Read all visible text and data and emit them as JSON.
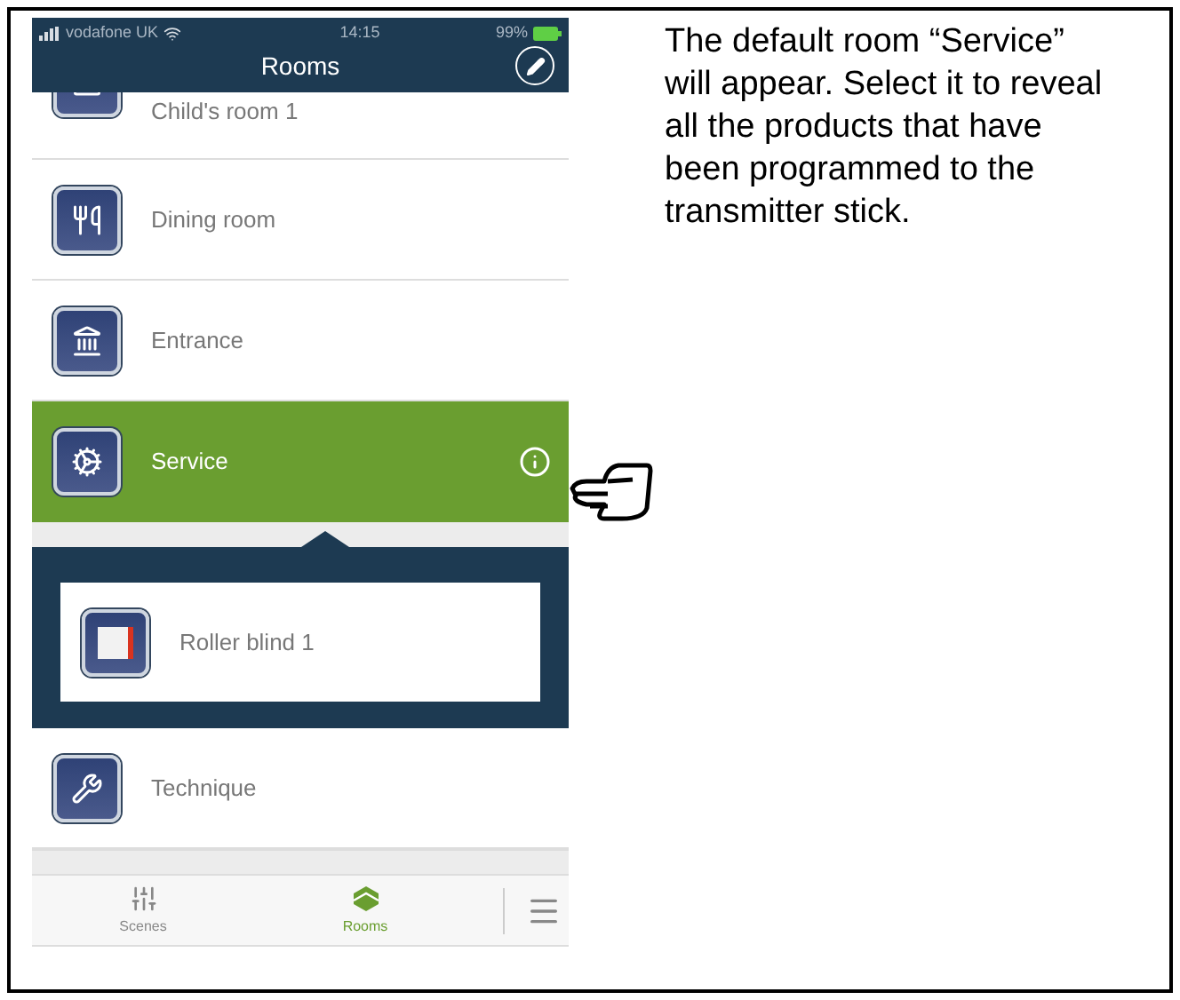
{
  "status_bar": {
    "carrier": "vodafone UK",
    "time": "14:15",
    "battery": "99%"
  },
  "header": {
    "title": "Rooms"
  },
  "rooms": [
    {
      "name": "Child's room 1",
      "selected": false
    },
    {
      "name": "Dining room",
      "selected": false
    },
    {
      "name": "Entrance",
      "selected": false
    },
    {
      "name": "Service",
      "selected": true,
      "devices": [
        {
          "name": "Roller blind 1"
        }
      ]
    },
    {
      "name": "Technique",
      "selected": false
    }
  ],
  "tab_bar": [
    {
      "label": "Scenes",
      "selected": false
    },
    {
      "label": "Rooms",
      "selected": true
    }
  ],
  "instruction": "The default room “Service” will appear. Select it to reveal all the products that have been programmed to the transmitter stick."
}
